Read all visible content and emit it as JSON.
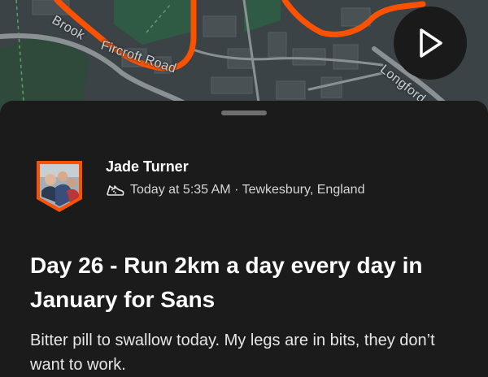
{
  "map": {
    "street_labels": [
      "Fircroft Road",
      "Longford",
      "Brook"
    ],
    "route_color": "#fc5200"
  },
  "play_button": {
    "icon": "play-icon"
  },
  "activity": {
    "athlete_name": "Jade Turner",
    "sport_icon": "running-shoe-icon",
    "meta": "Today at 5:35 AM · Tewkesbury, England",
    "title": "Day 26 - Run 2km a day every day in January for Sans",
    "description": "Bitter pill to swallow today. My legs are in bits, they don’t want to work."
  },
  "colors": {
    "accent": "#fc5200",
    "background": "#1b1b1b"
  }
}
